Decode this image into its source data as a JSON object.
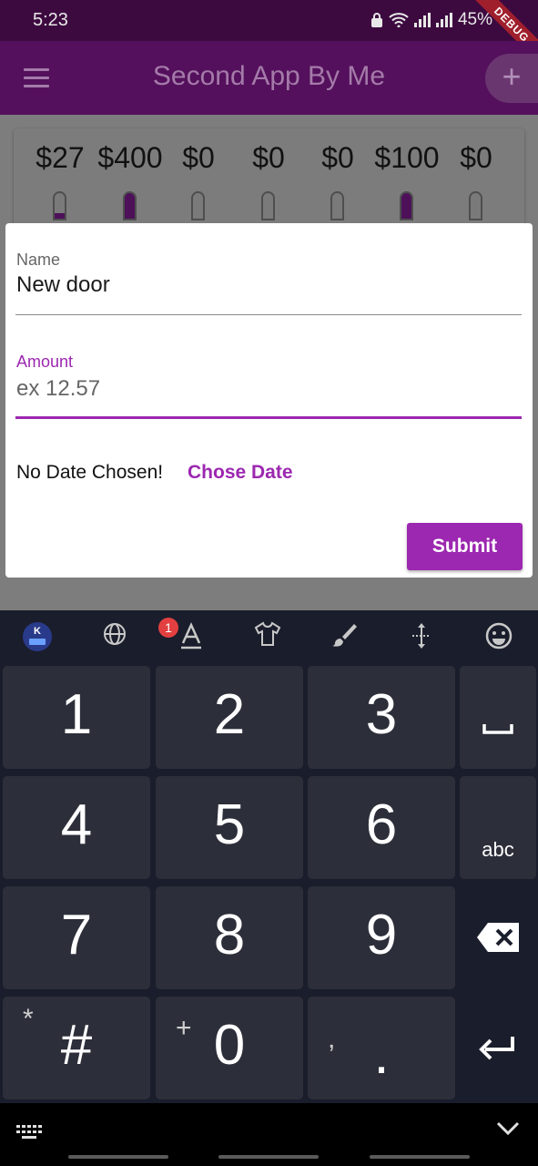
{
  "status_bar": {
    "time": "5:23",
    "battery": "45%",
    "debug_label": "DEBUG"
  },
  "app_bar": {
    "title": "Second App By Me"
  },
  "chart": {
    "bars": [
      {
        "amount": "$27",
        "fill_fraction": 0.2
      },
      {
        "amount": "$400",
        "fill_fraction": 1.0
      },
      {
        "amount": "$0",
        "fill_fraction": 0
      },
      {
        "amount": "$0",
        "fill_fraction": 0
      },
      {
        "amount": "$0",
        "fill_fraction": 0
      },
      {
        "amount": "$100",
        "fill_fraction": 1.0
      },
      {
        "amount": "$0",
        "fill_fraction": 0
      }
    ]
  },
  "form": {
    "name_label": "Name",
    "name_value": "New door",
    "amount_label": "Amount",
    "amount_placeholder": "ex 12.57",
    "no_date_text": "No Date Chosen!",
    "chose_date_label": "Chose Date",
    "submit_label": "Submit"
  },
  "keyboard": {
    "badge_count": "1",
    "keys": {
      "k1": "1",
      "k2": "2",
      "k3": "3",
      "k4": "4",
      "k5": "5",
      "k6": "6",
      "k7": "7",
      "k8": "8",
      "k9": "9",
      "hash": "#",
      "hash_hint": "*",
      "zero": "0",
      "zero_hint": "+",
      "period": ".",
      "period_hint": ",",
      "abc": "abc"
    }
  },
  "colors": {
    "accent": "#9c27b0",
    "app_bar_dimmed": "#54105c",
    "keyboard_bg": "#1a1d2b",
    "key_bg": "#2c2e39"
  }
}
